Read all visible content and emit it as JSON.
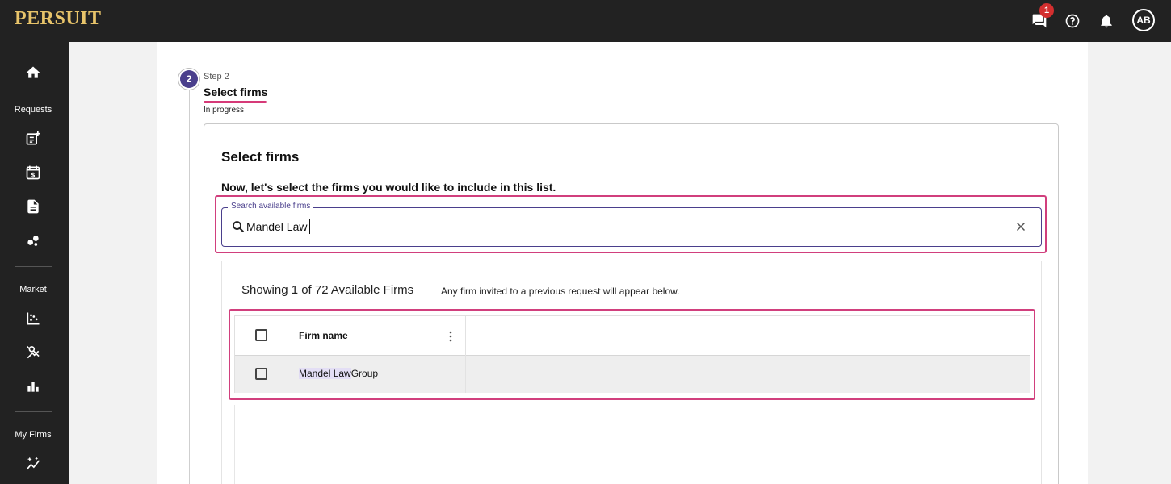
{
  "app": {
    "brand": "PERSUIT"
  },
  "header": {
    "notification_count": "1",
    "user_initials": "AB",
    "icons": [
      "chat-icon",
      "help-icon",
      "bell-icon"
    ]
  },
  "sidebar": {
    "sections": [
      {
        "label": "Requests"
      },
      {
        "label": "Market"
      },
      {
        "label": "My Firms"
      }
    ],
    "icons": [
      "home-icon",
      "new-request-icon",
      "pricing-calendar-icon",
      "document-icon",
      "workflow-icon",
      "scatter-chart-icon",
      "analytics-icon",
      "bar-chart-icon",
      "sparkle-icon"
    ]
  },
  "step": {
    "number": "2",
    "label": "Step 2",
    "title": "Select firms",
    "status": "In progress"
  },
  "card": {
    "title": "Select firms",
    "subtitle": "Now, let's select the firms you would like to include in this list."
  },
  "search": {
    "label": "Search available firms",
    "value": "Mandel Law"
  },
  "results": {
    "count_text": "Showing 1 of 72 Available Firms",
    "note": "Any firm invited to a previous request will appear below.",
    "column_header": "Firm name",
    "rows": [
      {
        "match": "Mandel Law",
        "rest": "Group"
      }
    ]
  },
  "colors": {
    "topbar": "#222222",
    "accent": "#4a3f8c",
    "highlight_border": "#d13f7d",
    "brand": "#e8c46a"
  }
}
